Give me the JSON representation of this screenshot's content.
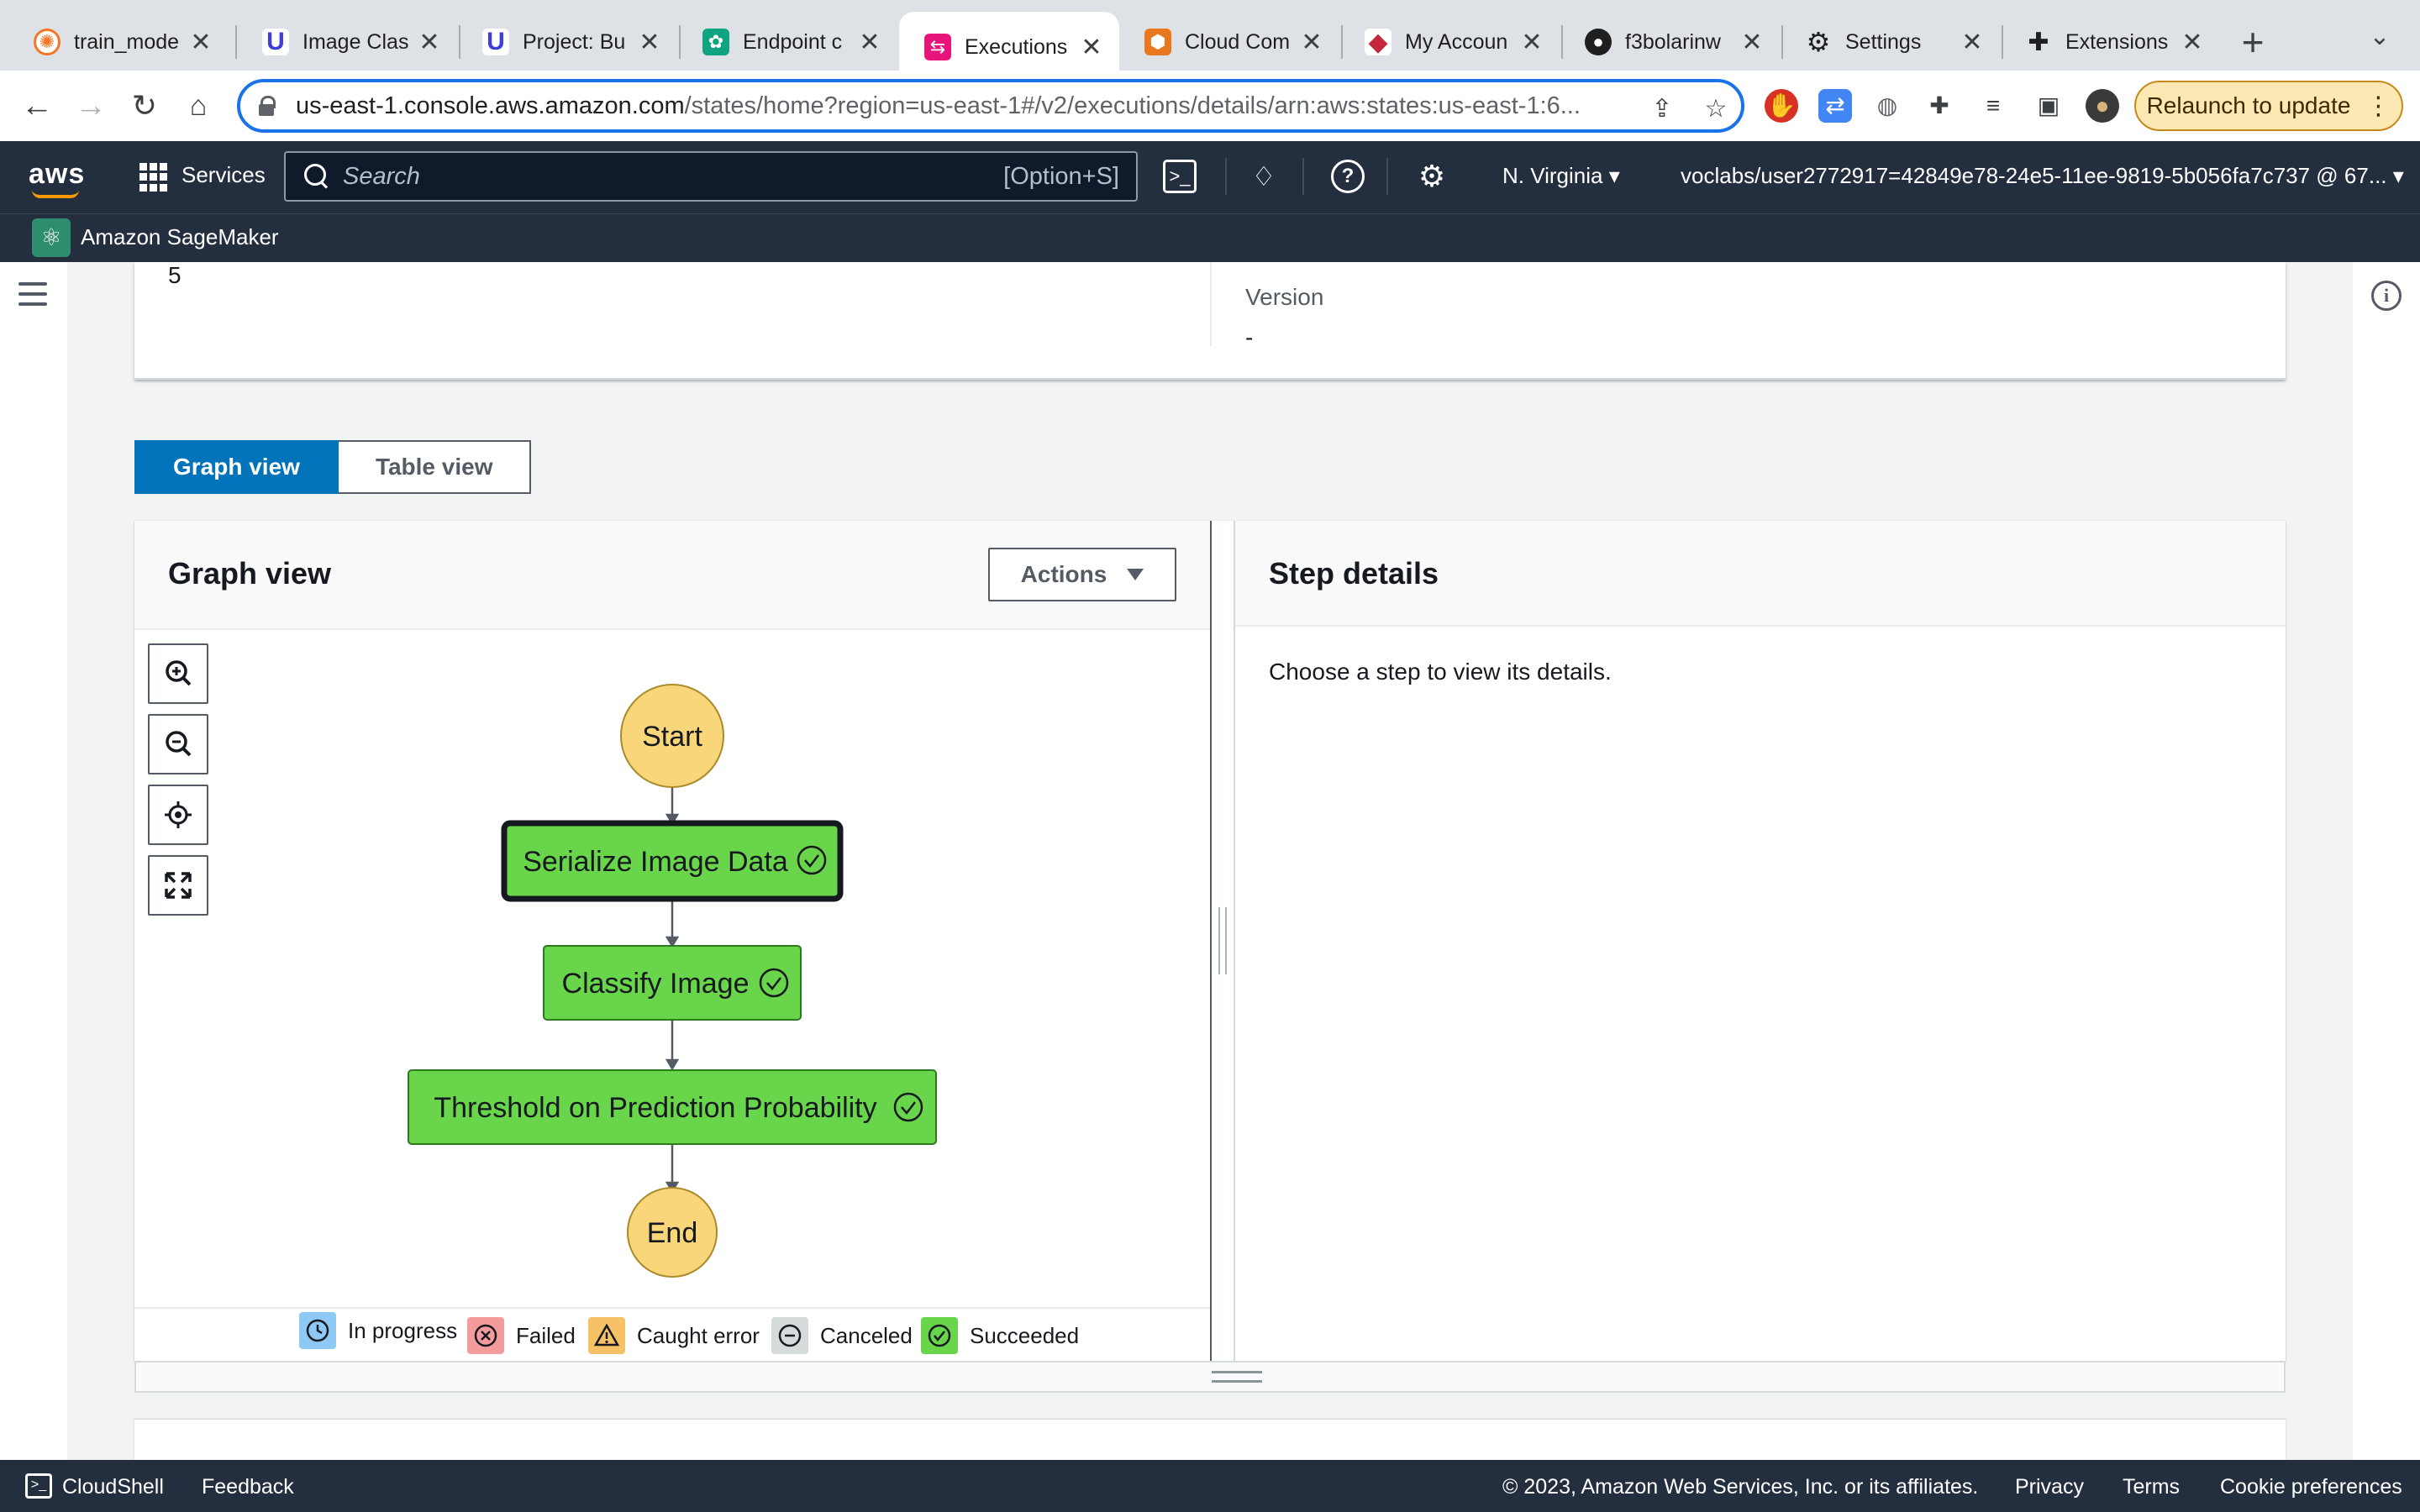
{
  "browser": {
    "tabs": [
      {
        "label": "train_mode",
        "icon": "jupyter-icon",
        "color": "#f37726"
      },
      {
        "label": "Image Clas",
        "icon": "udacity-icon",
        "color": "#02b3e4"
      },
      {
        "label": "Project: Bu",
        "icon": "udacity-icon",
        "color": "#02b3e4"
      },
      {
        "label": "Endpoint c",
        "icon": "openai-icon",
        "color": "#10a37f"
      },
      {
        "label": "Executions",
        "icon": "step-functions-icon",
        "color": "#e7157b"
      },
      {
        "label": "Cloud Com",
        "icon": "box-icon",
        "color": "#e8771d"
      },
      {
        "label": "My Accoun",
        "icon": "diamond-icon",
        "color": "#c5283d"
      },
      {
        "label": "f3bolarinw",
        "icon": "github-icon",
        "color": "#1f1f1f"
      },
      {
        "label": "Settings",
        "icon": "gear-icon",
        "color": "#1f1f1f"
      },
      {
        "label": "Extensions",
        "icon": "puzzle-icon",
        "color": "#1f1f1f"
      }
    ],
    "url_host": "us-east-1.console.aws.amazon.com",
    "url_path": "/states/home?region=us-east-1#/v2/executions/details/arn:aws:states:us-east-1:6...",
    "relaunch_label": "Relaunch to update"
  },
  "aws_nav": {
    "logo": "aws",
    "services_label": "Services",
    "search_placeholder": "Search",
    "search_shortcut": "[Option+S]",
    "region": "N. Virginia",
    "account": "voclabs/user2772917=42849e78-24e5-11ee-9819-5b056fa7c737 @ 67...",
    "service_name": "Amazon SageMaker"
  },
  "summary": {
    "left_value": "5",
    "version_label": "Version",
    "version_value": "-"
  },
  "view_toggle": {
    "graph": "Graph view",
    "table": "Table view"
  },
  "graph_panel": {
    "title": "Graph view",
    "actions_label": "Actions",
    "nodes": {
      "start": "Start",
      "serialize": "Serialize Image Data",
      "classify": "Classify Image",
      "threshold": "Threshold on Prediction Probability",
      "end": "End"
    },
    "legend": [
      "In progress",
      "Failed",
      "Caught error",
      "Canceled",
      "Succeeded"
    ]
  },
  "step_details": {
    "title": "Step details",
    "empty_text": "Choose a step to view its details."
  },
  "footer": {
    "cloudshell": "CloudShell",
    "feedback": "Feedback",
    "copyright": "© 2023, Amazon Web Services, Inc. or its affiliates.",
    "privacy": "Privacy",
    "terms": "Terms",
    "cookies": "Cookie preferences"
  },
  "colors": {
    "succeeded": "#69d54a",
    "start_end": "#f9d67a",
    "aws_nav": "#232f3e",
    "primary": "#0073bb"
  }
}
